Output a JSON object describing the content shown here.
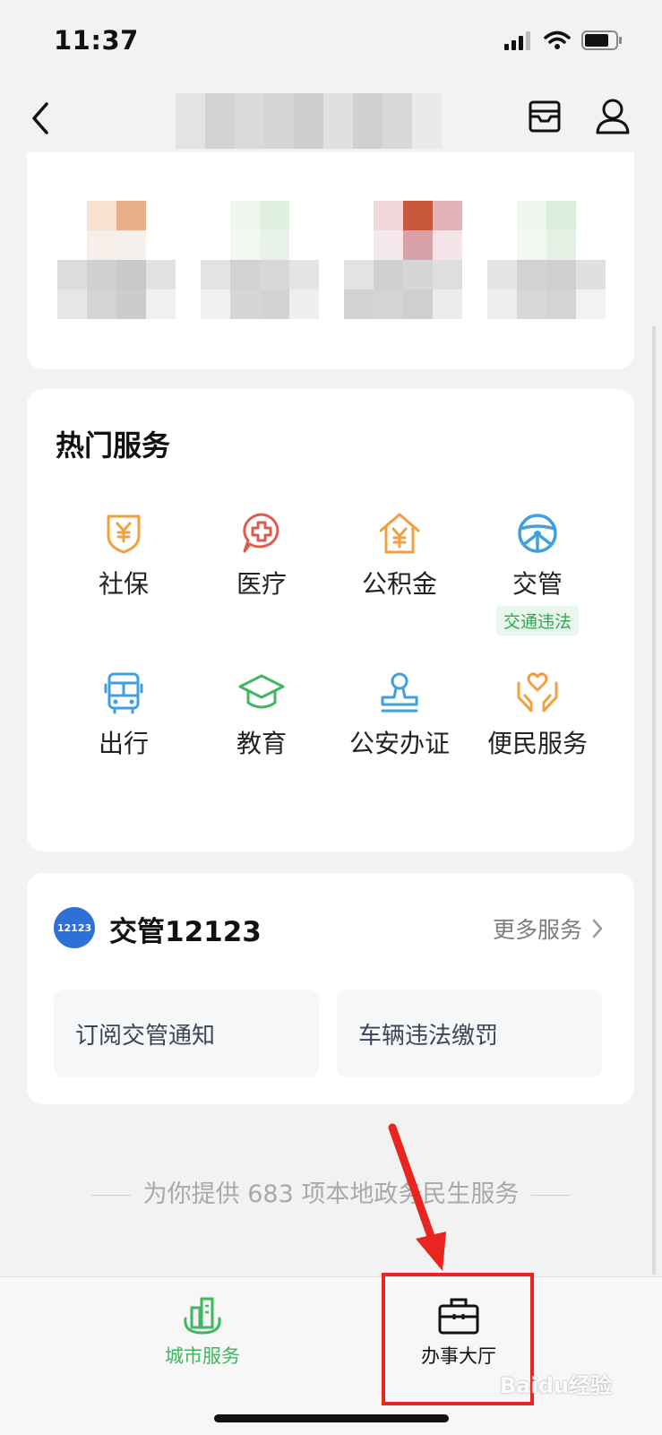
{
  "status_bar": {
    "time": "11:37"
  },
  "hot_services": {
    "title": "热门服务",
    "items": [
      {
        "label": "社保",
        "icon": "shield-yen-icon",
        "color": "#f0a040"
      },
      {
        "label": "医疗",
        "icon": "medical-cross-icon",
        "color": "#e05a4e"
      },
      {
        "label": "公积金",
        "icon": "house-yen-icon",
        "color": "#f0a040"
      },
      {
        "label": "交管",
        "icon": "steering-wheel-icon",
        "color": "#3ea0de",
        "tag": "交通违法"
      },
      {
        "label": "出行",
        "icon": "bus-icon",
        "color": "#3ea0de"
      },
      {
        "label": "教育",
        "icon": "graduation-cap-icon",
        "color": "#3fb660"
      },
      {
        "label": "公安办证",
        "icon": "stamp-icon",
        "color": "#3ea0de"
      },
      {
        "label": "便民服务",
        "icon": "hands-heart-icon",
        "color": "#f0a040"
      }
    ]
  },
  "jiaoguan": {
    "logo_text": "12123",
    "title": "交管12123",
    "more": "更多服务",
    "buttons": [
      "订阅交管通知",
      "车辆违法缴罚"
    ]
  },
  "footer": {
    "note": "为你提供 683 项本地政务民生服务"
  },
  "tabbar": {
    "tabs": [
      {
        "label": "城市服务",
        "active": true,
        "color": "#3fb660"
      },
      {
        "label": "办事大厅",
        "active": false,
        "color": "#111111"
      }
    ]
  },
  "watermark": "Baidu经验"
}
